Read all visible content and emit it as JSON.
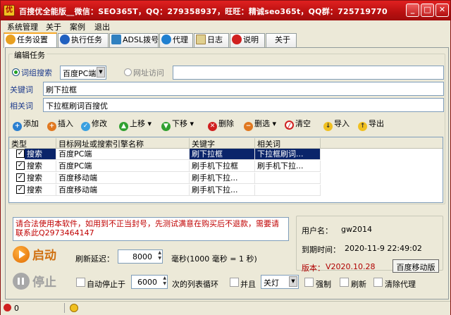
{
  "window": {
    "title": "百搜优全能版__微信：SEO365T，QQ：279358937，旺旺：精诚seo365t，QQ群：725719770",
    "icon_text": "优"
  },
  "menu": [
    "系统管理",
    "关于",
    "案例",
    "退出"
  ],
  "tabs": [
    {
      "label": "任务设置",
      "icon": "gear-icon",
      "color": "#e8a020",
      "active": true
    },
    {
      "label": "执行任务",
      "icon": "globe-icon",
      "color": "#2060c0"
    },
    {
      "label": "ADSL拨号",
      "icon": "network-icon",
      "color": "#3080c0"
    },
    {
      "label": "代理",
      "icon": "globe-icon",
      "color": "#2080d0"
    },
    {
      "label": "日志",
      "icon": "notepad-icon",
      "color": "#c0a040"
    },
    {
      "label": "说明",
      "icon": "heart-icon",
      "color": "#d02020"
    },
    {
      "label": "关于",
      "icon": "",
      "color": ""
    }
  ],
  "edit": {
    "group_label": "编辑任务",
    "radio_word": "词组搜索",
    "engine_value": "百度PC端",
    "radio_url": "网址访问",
    "url_value": "",
    "keyword_label": "关键词",
    "keyword_value": "刷下拉框",
    "related_label": "相关词",
    "related_value": "下拉框刷词百搜优"
  },
  "toolbar": {
    "add": "添加",
    "insert": "插入",
    "modify": "修改",
    "up": "上移",
    "down": "下移",
    "delete": "删除",
    "dedup": "删选",
    "clear": "清空",
    "import": "导入",
    "export": "导出"
  },
  "table": {
    "columns": [
      "类型",
      "目标网址或搜索引擎名称",
      "关键字",
      "相关词"
    ],
    "rows": [
      {
        "checked": true,
        "type": "搜索",
        "engine": "百度PC端",
        "keyword": "刷下拉框",
        "related": "下拉框刷词...",
        "selected": true
      },
      {
        "checked": true,
        "type": "搜索",
        "engine": "百度PC端",
        "keyword": "刷手机下拉框",
        "related": "刷手机下拉...",
        "selected": false
      },
      {
        "checked": true,
        "type": "搜索",
        "engine": "百度移动端",
        "keyword": "刷手机下拉...",
        "related": "",
        "selected": false
      },
      {
        "checked": true,
        "type": "搜索",
        "engine": "百度移动端",
        "keyword": "刷手机下拉...",
        "related": "",
        "selected": false
      }
    ]
  },
  "notice": "请合法使用本软件，如用到不正当封号，先测试满意在购买后不退款，需要请联系此Q2973464147",
  "controls": {
    "start": "启动",
    "stop": "停止",
    "delay_label": "刷新延迟：",
    "delay_value": "8000",
    "delay_unit": "毫秒(1000 毫秒 = 1 秒)",
    "auto_stop_label": "自动停止于",
    "auto_stop_value": "6000",
    "auto_stop_unit": "次的列表循环",
    "parallel_label": "并且",
    "parallel_value": "关灯",
    "force_label": "强制",
    "refresh_label": "刷新",
    "clear_proxy_label": "清除代理"
  },
  "user": {
    "name_label": "用户名：",
    "name_value": "gw2014",
    "expire_label": "到期时间：",
    "expire_value": "2020-11-9 22:49:02",
    "version_label": "版本：",
    "version_value": "V2020.10.28",
    "mode_button": "百度移动版"
  },
  "statusbar": {
    "count_left": "0",
    "count_right": ""
  },
  "colors": {
    "title_bar": "#c01818",
    "accent_tab": "#f6a828",
    "selected_row": "#0a246a",
    "notice_text": "#c00000"
  }
}
